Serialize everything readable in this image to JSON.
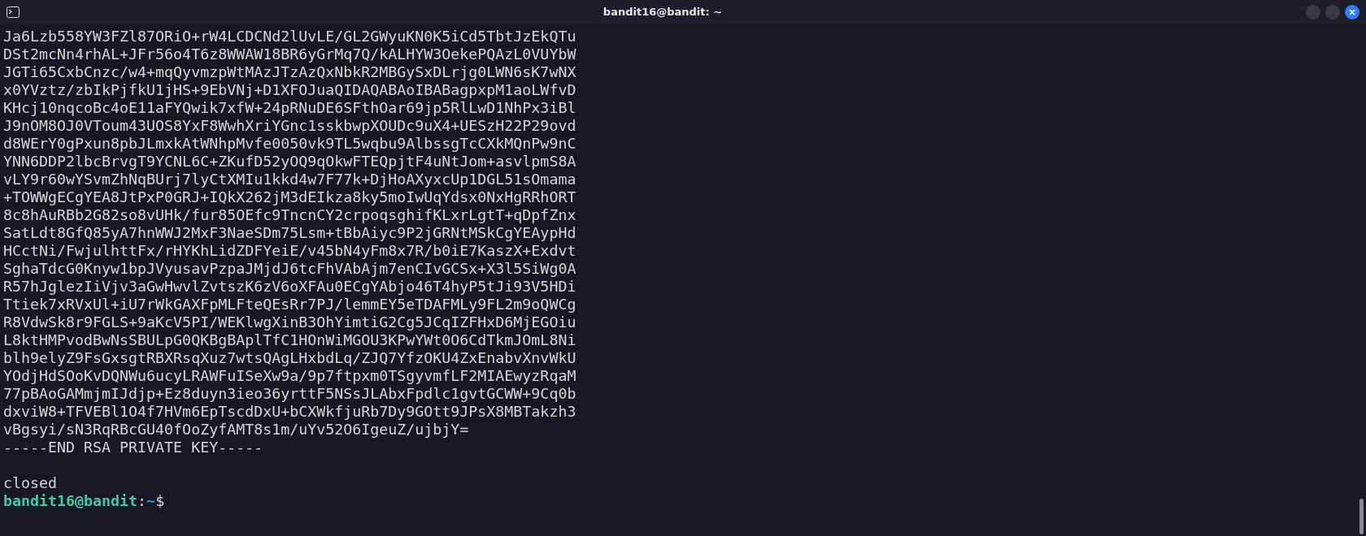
{
  "window": {
    "title": "bandit16@bandit: ~"
  },
  "terminal": {
    "key_lines": [
      "Ja6Lzb558YW3FZl87ORiO+rW4LCDCNd2lUvLE/GL2GWyuKN0K5iCd5TbtJzEkQTu",
      "DSt2mcNn4rhAL+JFr56o4T6z8WWAW18BR6yGrMq7Q/kALHYW3OekePQAzL0VUYbW",
      "JGTi65CxbCnzc/w4+mqQyvmzpWtMAzJTzAzQxNbkR2MBGySxDLrjg0LWN6sK7wNX",
      "x0YVztz/zbIkPjfkU1jHS+9EbVNj+D1XFOJuaQIDAQABAoIBABagpxpM1aoLWfvD",
      "KHcj10nqcoBc4oE11aFYQwik7xfW+24pRNuDE6SFthOar69jp5RlLwD1NhPx3iBl",
      "J9nOM8OJ0VToum43UOS8YxF8WwhXriYGnc1sskbwpXOUDc9uX4+UESzH22P29ovd",
      "d8WErY0gPxun8pbJLmxkAtWNhpMvfe0050vk9TL5wqbu9AlbssgTcCXkMQnPw9nC",
      "YNN6DDP2lbcBrvgT9YCNL6C+ZKufD52yOQ9qOkwFTEQpjtF4uNtJom+asvlpmS8A",
      "vLY9r60wYSvmZhNqBUrj7lyCtXMIu1kkd4w7F77k+DjHoAXyxcUp1DGL51sOmama",
      "+TOWWgECgYEA8JtPxP0GRJ+IQkX262jM3dEIkza8ky5moIwUqYdsx0NxHgRRhORT",
      "8c8hAuRBb2G82so8vUHk/fur85OEfc9TncnCY2crpoqsghifKLxrLgtT+qDpfZnx",
      "SatLdt8GfQ85yA7hnWWJ2MxF3NaeSDm75Lsm+tBbAiyc9P2jGRNtMSkCgYEAypHd",
      "HCctNi/FwjulhttFx/rHYKhLidZDFYeiE/v45bN4yFm8x7R/b0iE7KaszX+Exdvt",
      "SghaTdcG0Knyw1bpJVyusavPzpaJMjdJ6tcFhVAbAjm7enCIvGCSx+X3l5SiWg0A",
      "R57hJglezIiVjv3aGwHwvlZvtszK6zV6oXFAu0ECgYAbjo46T4hyP5tJi93V5HDi",
      "Ttiek7xRVxUl+iU7rWkGAXFpMLFteQEsRr7PJ/lemmEY5eTDAFMLy9FL2m9oQWCg",
      "R8VdwSk8r9FGLS+9aKcV5PI/WEKlwgXinB3OhYimtiG2Cg5JCqIZFHxD6MjEGOiu",
      "L8ktHMPvodBwNsSBULpG0QKBgBAplTfC1HOnWiMGOU3KPwYWt0O6CdTkmJOmL8Ni",
      "blh9elyZ9FsGxsgtRBXRsqXuz7wtsQAgLHxbdLq/ZJQ7YfzOKU4ZxEnabvXnvWkU",
      "YOdjHdSOoKvDQNWu6ucyLRAWFuISeXw9a/9p7ftpxm0TSgyvmfLF2MIAEwyzRqaM",
      "77pBAoGAMmjmIJdjp+Ez8duyn3ieo36yrttF5NSsJLAbxFpdlc1gvtGCWW+9Cq0b",
      "dxviW8+TFVEBl1O4f7HVm6EpTscdDxU+bCXWkfjuRb7Dy9GOtt9JPsX8MBTakzh3",
      "vBgsyi/sN3RqRBcGU40fOoZyfAMT8s1m/uYv52O6IgeuZ/ujbjY=",
      "-----END RSA PRIVATE KEY-----"
    ],
    "connection_status": "closed",
    "prompt": {
      "user_host": "bandit16@bandit",
      "separator": ":",
      "path": "~",
      "symbol": "$"
    }
  }
}
